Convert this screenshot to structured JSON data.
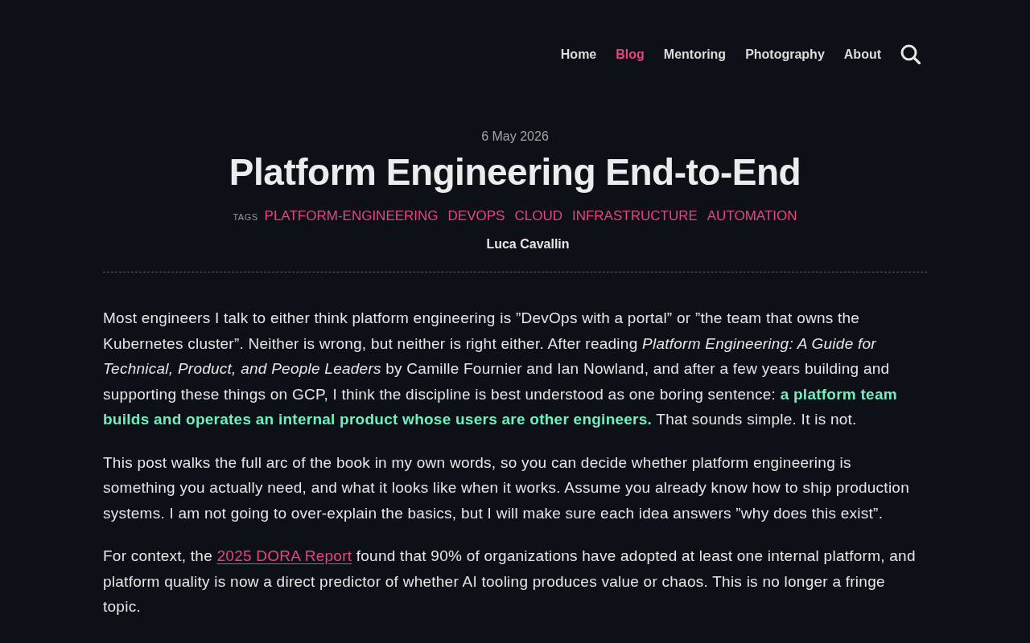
{
  "nav": {
    "items": [
      {
        "label": "Home",
        "selected": false
      },
      {
        "label": "Blog",
        "selected": true
      },
      {
        "label": "Mentoring",
        "selected": false
      },
      {
        "label": "Photography",
        "selected": false
      },
      {
        "label": "About",
        "selected": false
      }
    ]
  },
  "post": {
    "date": "6 May 2026",
    "title": "Platform Engineering End-to-End",
    "tags_label": "TAGS",
    "tags": [
      "PLATFORM-ENGINEERING",
      "DEVOPS",
      "CLOUD",
      "INFRASTRUCTURE",
      "AUTOMATION"
    ],
    "author": "Luca Cavallin",
    "paragraphs": [
      {
        "runs": [
          {
            "kind": "text",
            "text": "Most engineers I talk to either think platform engineering is ”DevOps with a portal” or ”the team that owns the Kubernetes cluster”. Neither is wrong, but neither is right either. After reading *Platform Engineering: A Guide for Technical, Product, and People Leaders* by Camille Fournier and Ian Nowland, and after a few years building and supporting these things on GCP, I think the discipline is best understood as one boring sentence: **a platform team builds and operates an internal product whose users are other engineers.** That sounds simple. It is not."
          }
        ]
      },
      {
        "runs": [
          {
            "kind": "text",
            "text": "This post walks the full arc of the book in my own words, so you can decide whether platform engineering is something you actually need, and what it looks like when it works. Assume you already know how to ship production systems. I am not going to over-explain the basics, but I will make sure each idea answers ”why does this exist”."
          }
        ]
      },
      {
        "runs": [
          {
            "kind": "text",
            "text": "For context, the "
          },
          {
            "kind": "link",
            "text": "2025 DORA Report"
          },
          {
            "kind": "text",
            "text": " found that 90% of organizations have adopted at least one internal platform, and platform quality is now a direct predictor of whether AI tooling produces value or chaos. This is no longer a fringe topic."
          }
        ]
      }
    ]
  }
}
